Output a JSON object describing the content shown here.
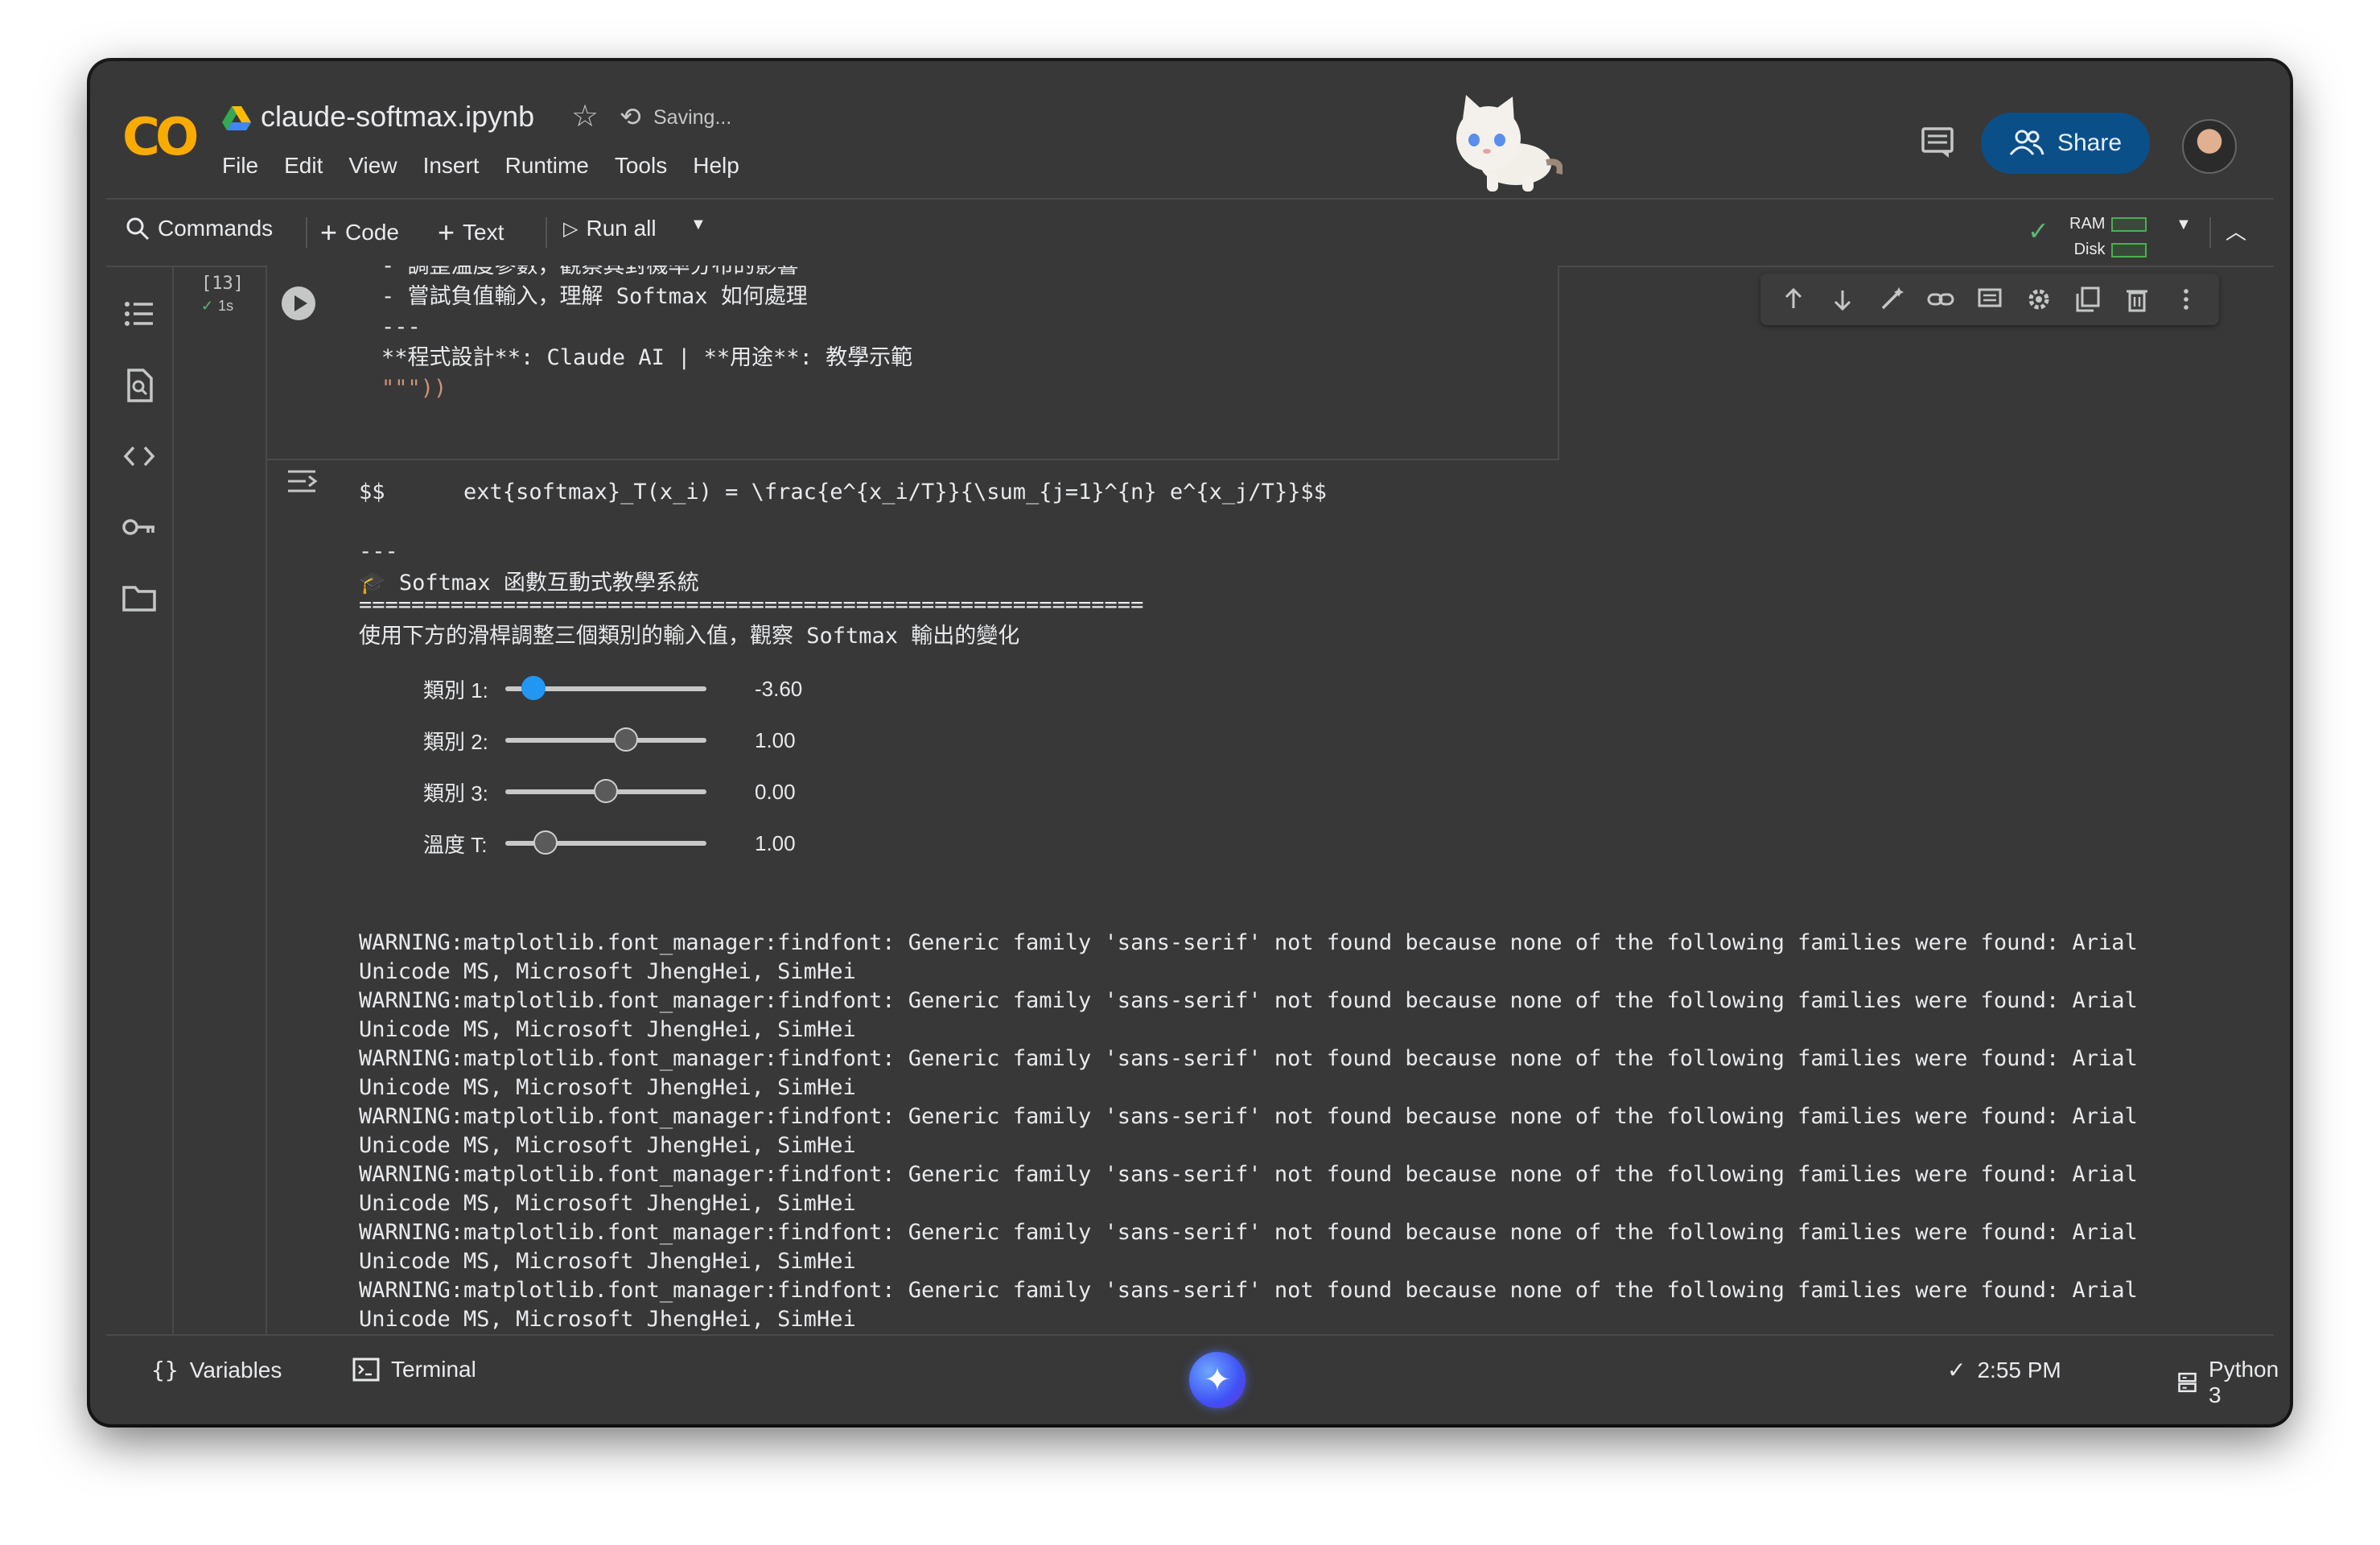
{
  "header": {
    "logo_text": "CO",
    "filename": "claude-softmax.ipynb",
    "status": "Saving...",
    "menu": [
      "File",
      "Edit",
      "View",
      "Insert",
      "Runtime",
      "Tools",
      "Help"
    ],
    "share_label": "Share"
  },
  "toolbar": {
    "commands": "Commands",
    "add_code": "Code",
    "add_text": "Text",
    "run_all": "Run all",
    "ram_label": "RAM",
    "disk_label": "Disk"
  },
  "cell": {
    "exec_count": "[13]",
    "exec_time": "1s",
    "code_lines": [
      "- 調整溫度參數，觀察其對機率分布的影響",
      "- 嘗試負值輸入，理解 Softmax 如何處理",
      "",
      "---",
      "**程式設計**: Claude AI | **用途**: 教學示範",
      "\"\"\"))"
    ]
  },
  "output": {
    "latex_line": "$$      ext{softmax}_T(x_i) = \\frac{e^{x_i/T}}{\\sum_{j=1}^{n} e^{x_j/T}}$$",
    "divider": "---",
    "heading": "🎓 Softmax 函數互動式教學系統",
    "equals_line": "============================================================",
    "instruction": "使用下方的滑桿調整三個類別的輸入值，觀察 Softmax 輸出的變化",
    "sliders": [
      {
        "label": "類別 1:",
        "value": "-3.60",
        "fraction": 0.14,
        "active": true
      },
      {
        "label": "類別 2:",
        "value": "1.00",
        "fraction": 0.6,
        "active": false
      },
      {
        "label": "類別 3:",
        "value": "0.00",
        "fraction": 0.5,
        "active": false
      },
      {
        "label": "溫度 T:",
        "value": "1.00",
        "fraction": 0.2,
        "active": false
      }
    ],
    "warning_line1": "WARNING:matplotlib.font_manager:findfont: Generic family 'sans-serif' not found because none of the following families were found: Arial",
    "warning_line2": "Unicode MS, Microsoft JhengHei, SimHei",
    "warning_repeat": 9
  },
  "statusbar": {
    "variables": "Variables",
    "terminal": "Terminal",
    "time": "2:55 PM",
    "kernel": "Python 3"
  }
}
